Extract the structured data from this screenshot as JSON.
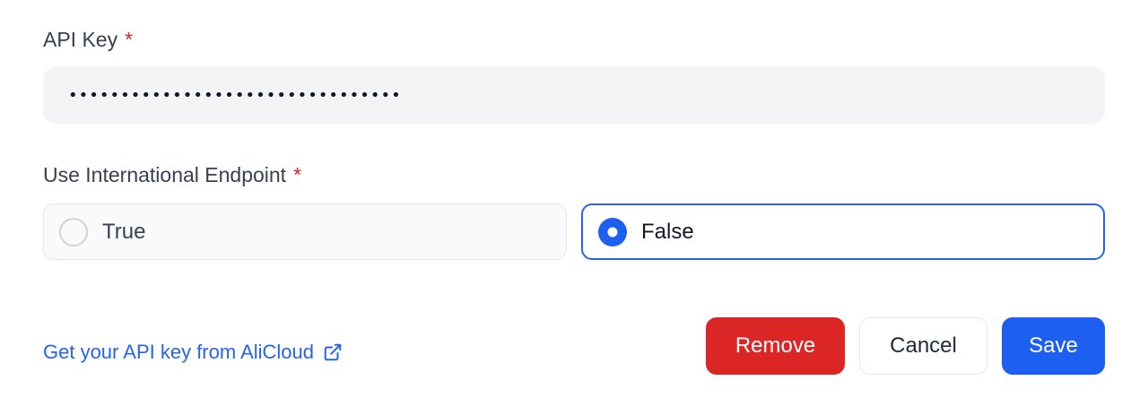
{
  "form": {
    "api_key_label": "API Key",
    "required_mark": "*",
    "api_key_value": "••••••••••••••••••••••••••••••••",
    "endpoint_label": "Use International Endpoint",
    "options": [
      {
        "label": "True",
        "selected": false
      },
      {
        "label": "False",
        "selected": true
      }
    ]
  },
  "footer": {
    "link_text": "Get your API key from AliCloud",
    "link_icon": "external-link-icon",
    "remove_label": "Remove",
    "cancel_label": "Cancel",
    "save_label": "Save"
  },
  "colors": {
    "accent": "#1d5ff0",
    "danger": "#dc2626",
    "required": "#dc2626",
    "link": "#2563eb"
  }
}
